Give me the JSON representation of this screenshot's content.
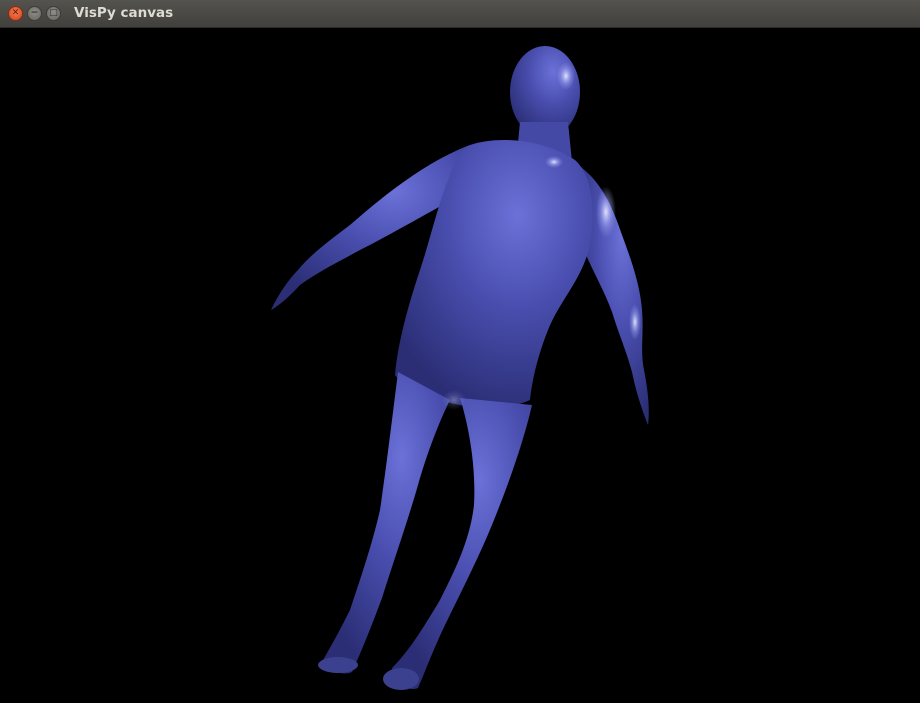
{
  "window": {
    "title": "VisPy canvas",
    "controls": {
      "close_icon": "close-icon",
      "minimize_icon": "minimize-icon",
      "maximize_icon": "maximize-icon"
    }
  },
  "scene": {
    "subject": "human body mesh",
    "mesh_color": "#4a4fb0",
    "highlight_color": "#aeb3ff",
    "background_color": "#000000"
  }
}
